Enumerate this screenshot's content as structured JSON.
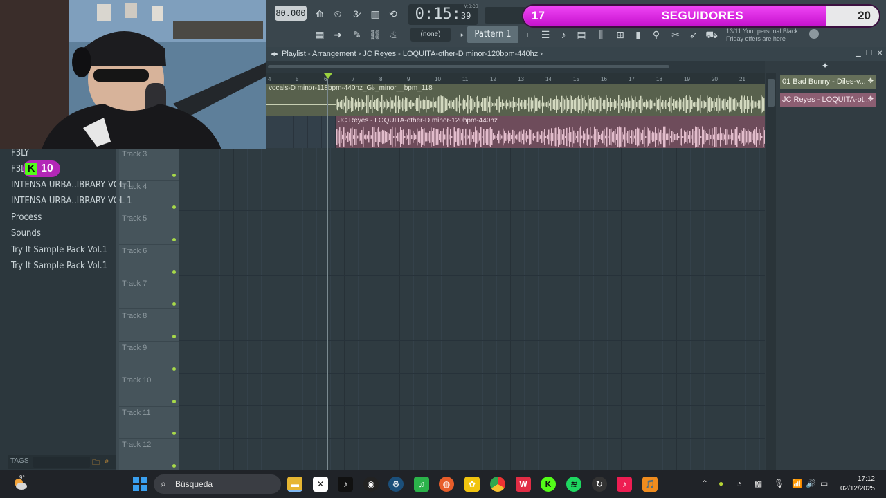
{
  "toolbar": {
    "tempo": "80.000",
    "time_main": "0:15",
    "time_sub": "39",
    "time_unit": "M:S:CS",
    "snap": "(none)",
    "pattern": "Pattern 1",
    "promo_line1": "13/11  Your personal Black",
    "promo_line2": "Friday offers are here"
  },
  "followers": {
    "current": "17",
    "label": "SEGUIDORES",
    "goal": "20",
    "progress": 0.85
  },
  "playlist": {
    "title": "Playlist - Arrangement",
    "sep": "›",
    "current": "JC Reyes - LOQUITA-other-D minor-120bpm-440hz",
    "end_chevron": "›",
    "ruler": [
      "4",
      "5",
      "6",
      "7",
      "8",
      "9",
      "10",
      "11",
      "12",
      "13",
      "14",
      "15",
      "16",
      "17",
      "18",
      "19",
      "20",
      "21"
    ],
    "clips": [
      {
        "title": "vocals-D minor-118bpm-440hz_G♭_minor__bpm_118"
      },
      {
        "title": "JC Reyes - LOQUITA-other-D minor-120bpm-440hz"
      }
    ],
    "tracks": [
      "Track 3",
      "Track 4",
      "Track 5",
      "Track 6",
      "Track 7",
      "Track 8",
      "Track 9",
      "Track 10",
      "Track 11",
      "Track 12"
    ]
  },
  "picker": {
    "items": [
      "01 Bad Bunny - Diles-v...",
      "JC Reyes - LOQUITA-ot..."
    ]
  },
  "browser": {
    "items": [
      "F3LY",
      "F3L",
      "INTENSA URBA..IBRARY VOL 1",
      "INTENSA URBA..IBRARY VOL 1",
      "Process",
      "Sounds",
      "Try It Sample Pack Vol.1",
      "Try It Sample Pack Vol.1"
    ],
    "tags_label": "TAGS"
  },
  "kick": {
    "letter": "K",
    "count": "10"
  },
  "taskbar": {
    "weather_temp": "9°",
    "search_placeholder": "Búsqueda",
    "time": "17:12",
    "date": "02/12/2025"
  },
  "colors": {
    "accent_magenta": "#c511cd",
    "kick_green": "#53fc18",
    "playhead_green": "#9bd23f",
    "clip_vocals": "#58614d",
    "clip_other": "#6e4c5b"
  }
}
